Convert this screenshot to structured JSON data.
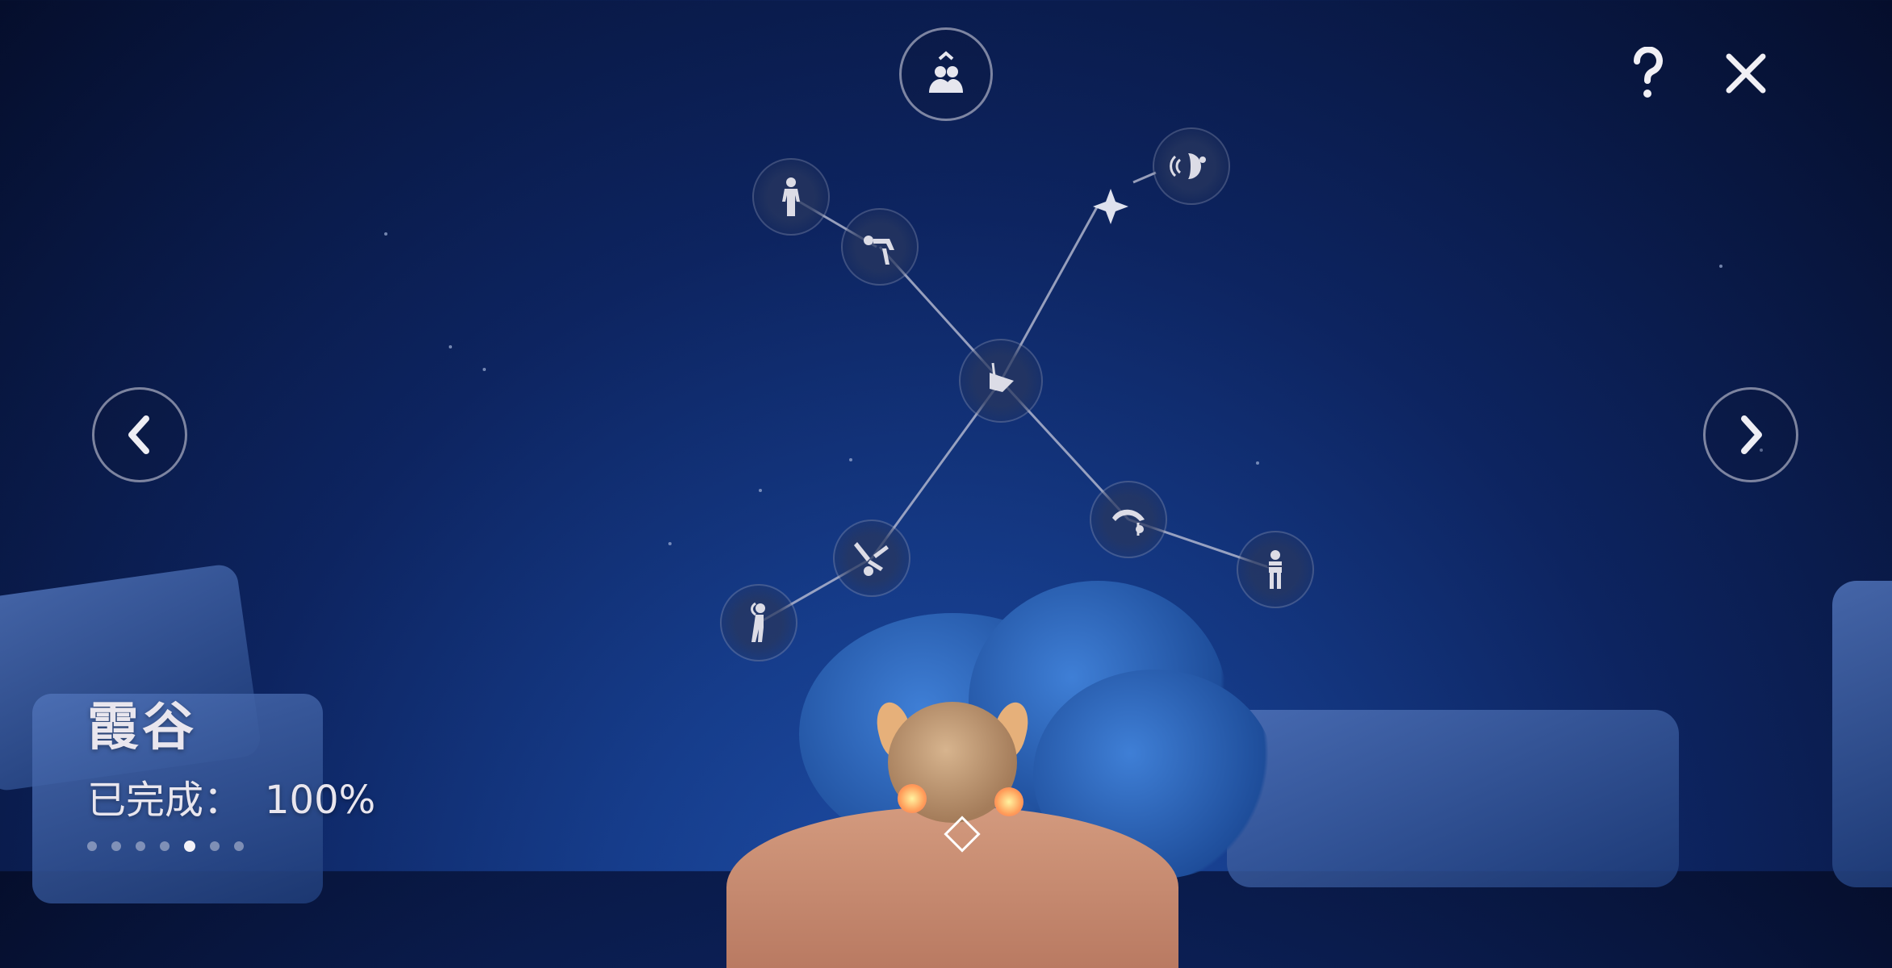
{
  "realm": {
    "name": "霞谷",
    "progress_label": "已完成：",
    "progress_value": "100%",
    "progress_fraction": 1.0,
    "page_dots": 7,
    "active_page": 5
  },
  "buttons": {
    "friends": "friends-icon",
    "help": "question-icon",
    "close": "close-icon",
    "prev": "chevron-left-icon",
    "next": "chevron-right-icon"
  },
  "constellation": {
    "nodes": [
      {
        "id": "top-left-1",
        "icon": "standing-person-icon"
      },
      {
        "id": "top-left-2",
        "icon": "bowing-person-icon"
      },
      {
        "id": "top-right",
        "icon": "cheering-person-icon"
      },
      {
        "id": "center",
        "icon": "shield-sled-icon"
      },
      {
        "id": "bottom-right-1",
        "icon": "backflip-person-icon"
      },
      {
        "id": "bottom-right-2",
        "icon": "arms-crossed-person-icon"
      },
      {
        "id": "bottom-left-1",
        "icon": "cartwheel-person-icon"
      },
      {
        "id": "bottom-left-2",
        "icon": "stretching-person-icon"
      }
    ]
  },
  "colors": {
    "sky_top": "#050e2c",
    "sky_bottom": "#1f4fa8",
    "ui_line": "#c8c8d8"
  }
}
